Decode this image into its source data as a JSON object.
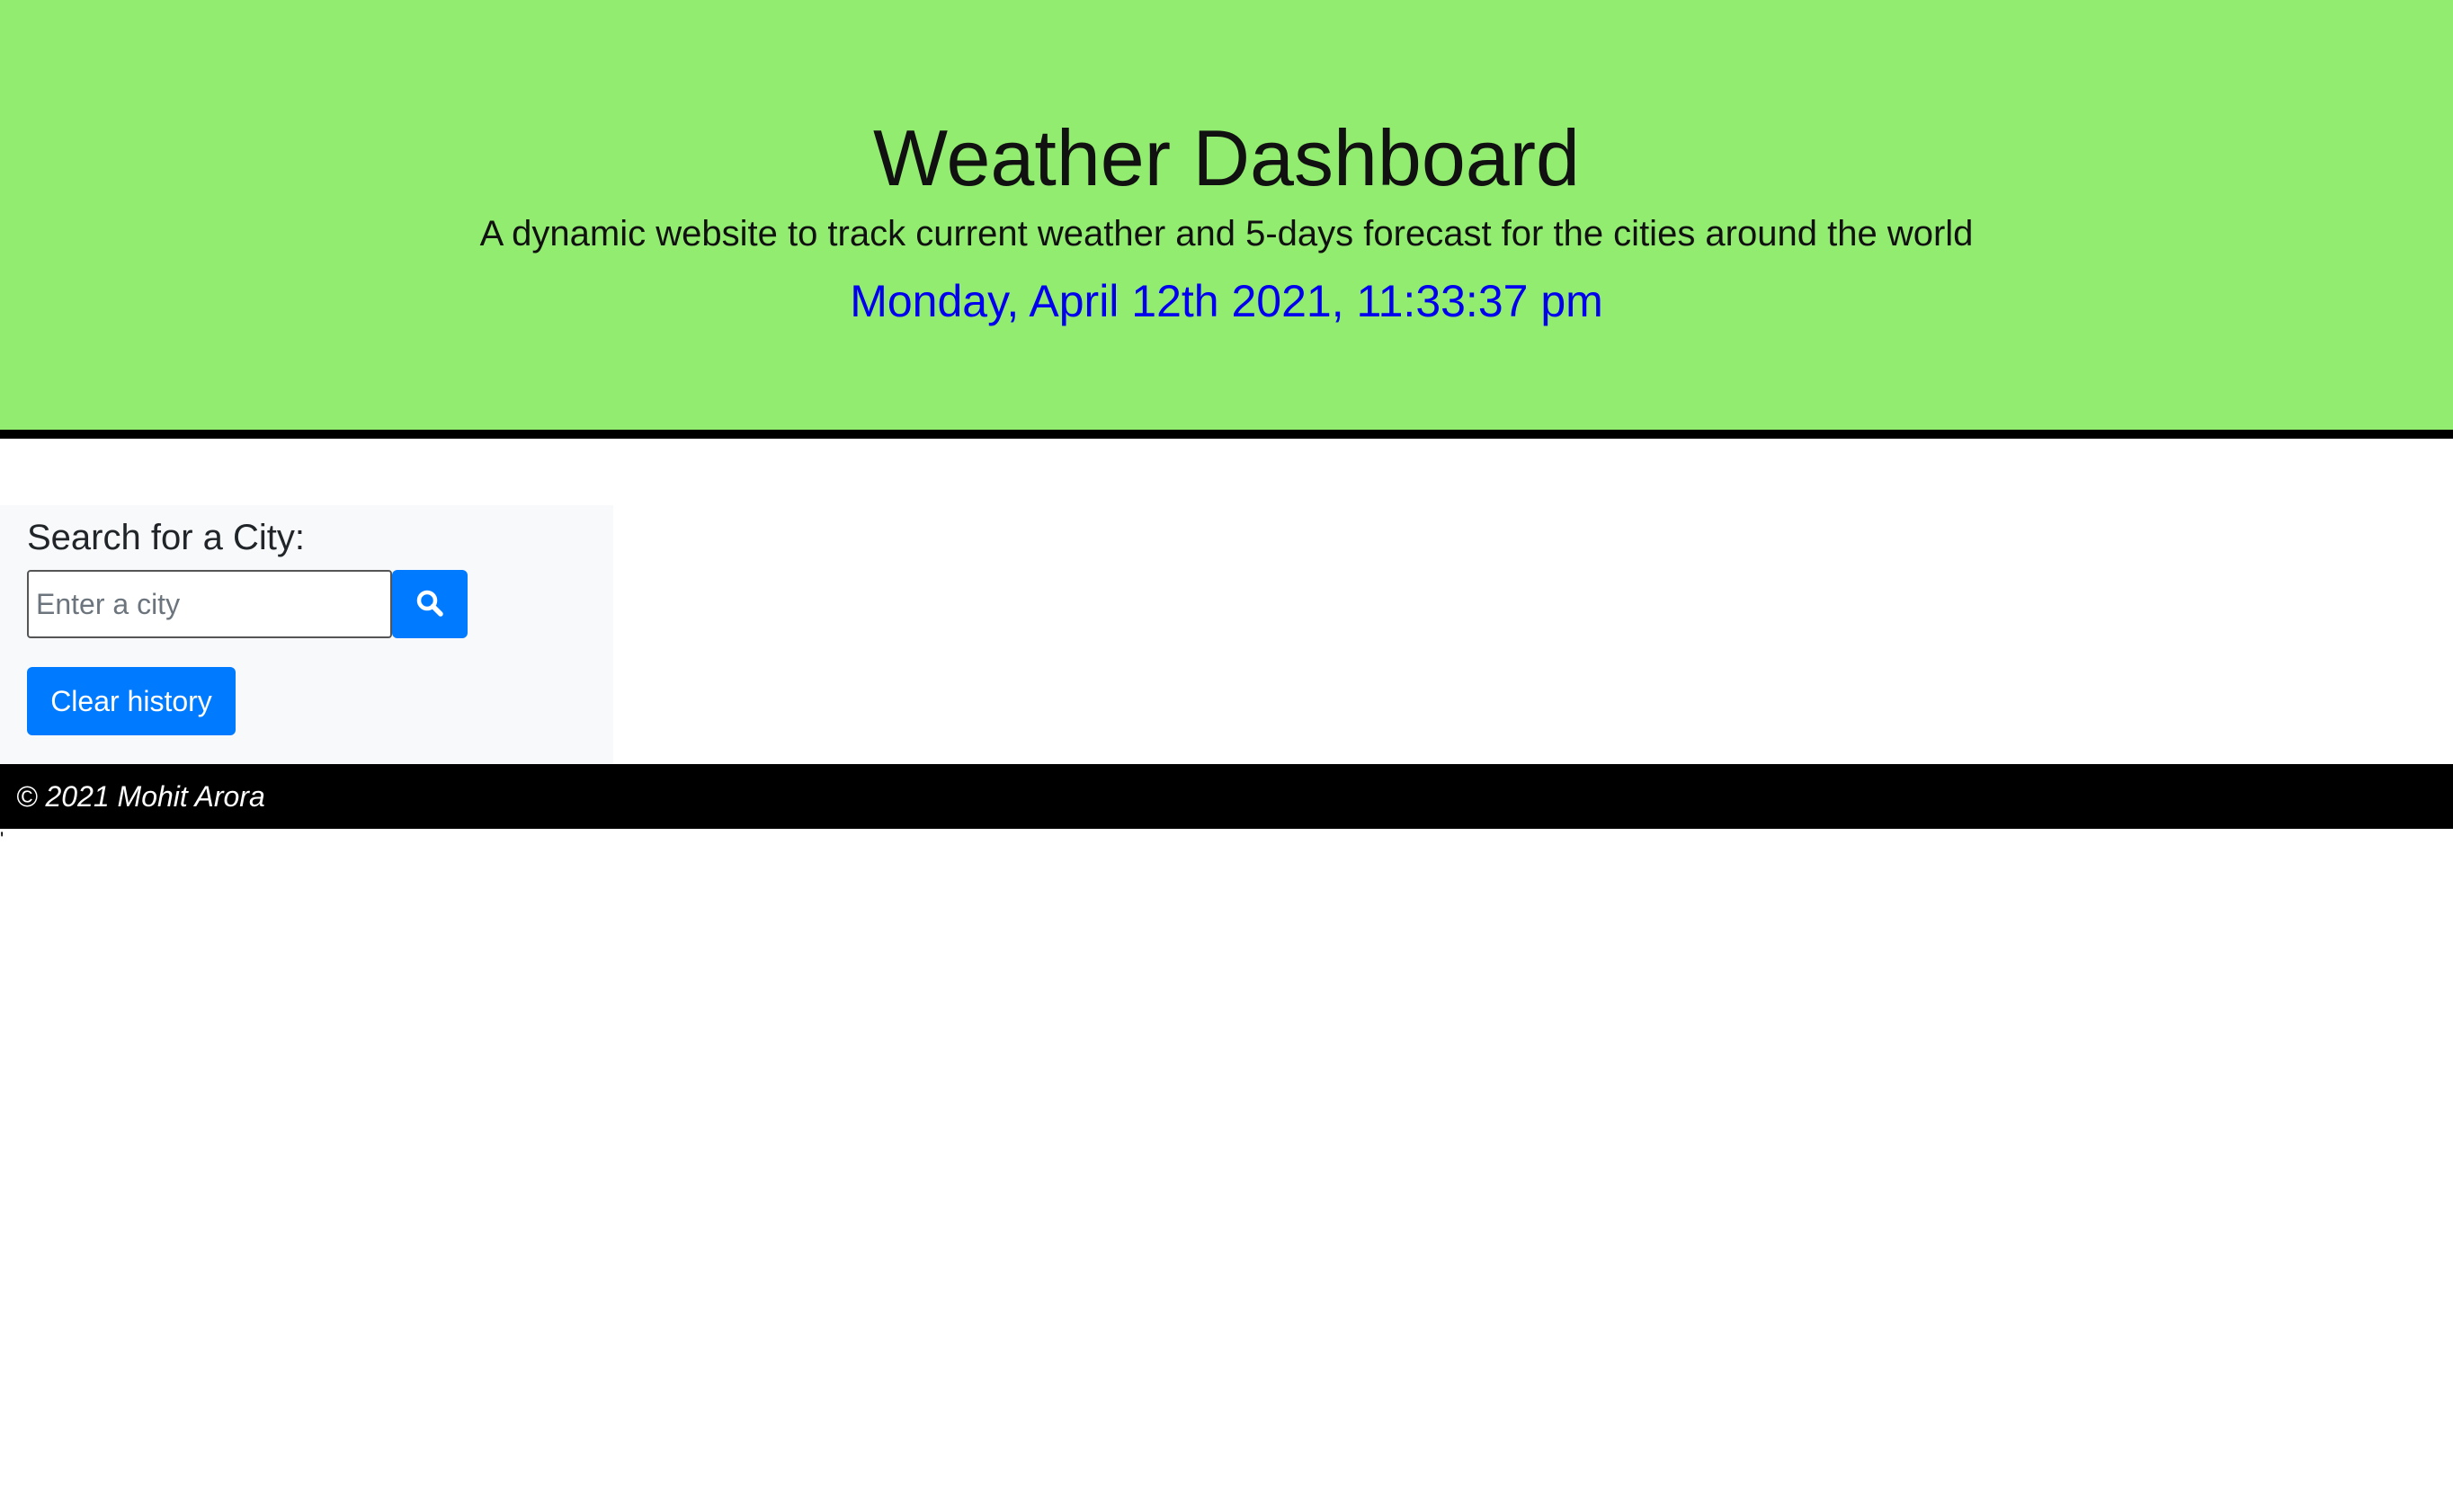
{
  "header": {
    "title": "Weather Dashboard",
    "subtitle": "A dynamic website to track current weather and 5-days forecast for the cities around the world",
    "datetime": "Monday, April 12th 2021, 11:33:37 pm"
  },
  "search": {
    "label": "Search for a City:",
    "placeholder": "Enter a city",
    "value": "",
    "button_icon": "search-icon",
    "clear_label": "Clear history"
  },
  "footer": {
    "copyright": "© 2021 Mohit Arora"
  },
  "stray_text": "'",
  "colors": {
    "header_bg": "#92ec6f",
    "accent": "#007bff",
    "datetime": "#0000ee",
    "footer_bg": "#000000",
    "sidebar_bg": "#f8f9fa"
  }
}
